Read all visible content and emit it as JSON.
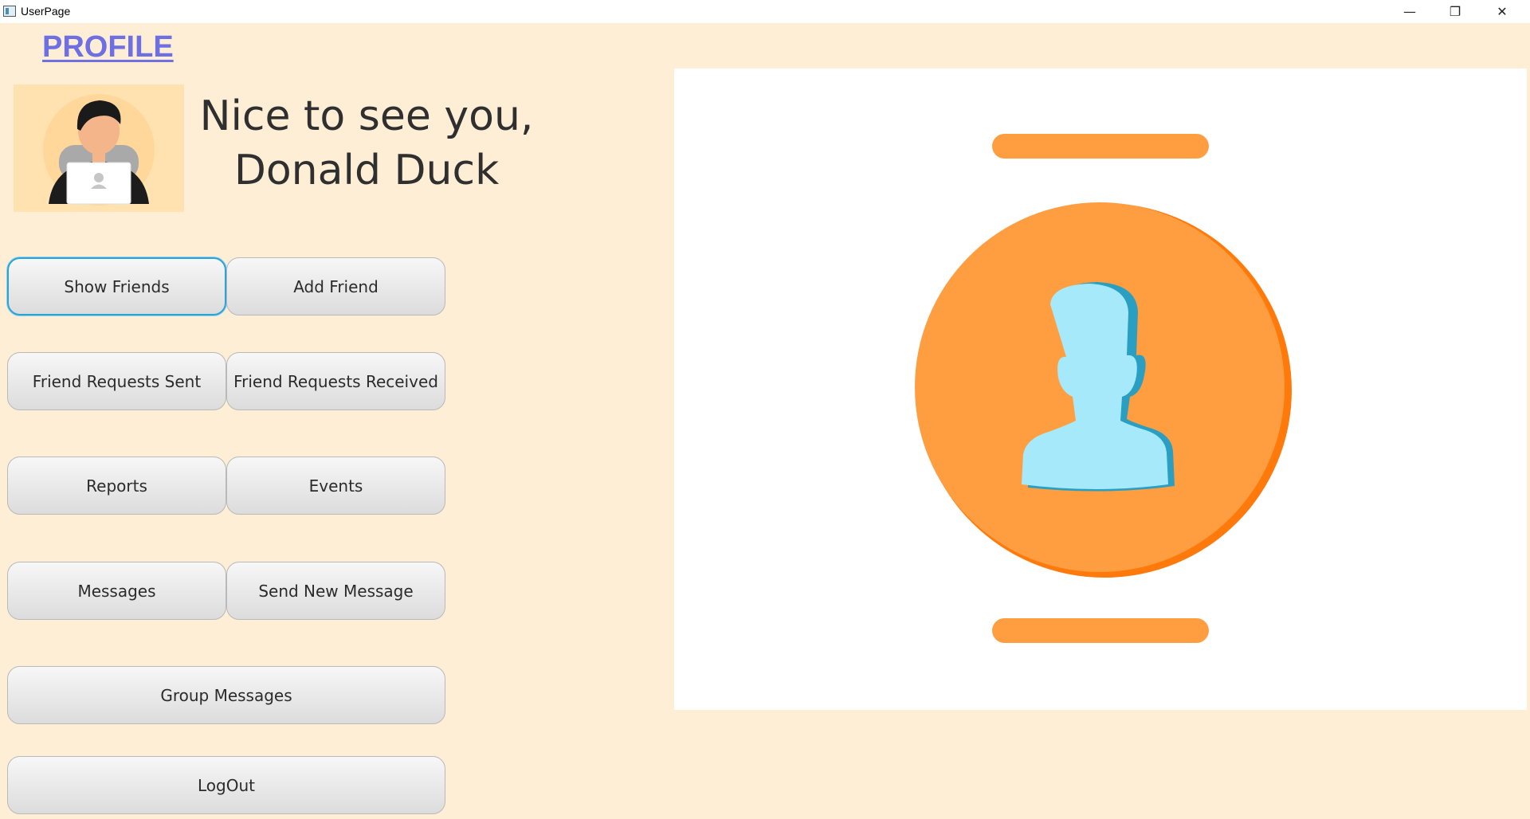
{
  "window": {
    "title": "UserPage",
    "controls": {
      "minimize": "—",
      "maximize": "❐",
      "close": "✕"
    }
  },
  "header": {
    "profile_label": "PROFILE"
  },
  "greeting": {
    "line1": "Nice to see you,",
    "line2": "Donald Duck"
  },
  "buttons": {
    "show_friends": "Show Friends",
    "add_friend": "Add Friend",
    "friend_requests_sent": "Friend Requests Sent",
    "friend_requests_received": "Friend Requests Received",
    "reports": "Reports",
    "events": "Events",
    "messages": "Messages",
    "send_new_message": "Send New Message",
    "group_messages": "Group Messages",
    "logout": "LogOut"
  },
  "colors": {
    "background": "#fdeed5",
    "accent_link": "#6f6fe4",
    "focus_ring": "#2aa3d8",
    "orange": "#ff9e40",
    "orange_dark": "#ff7a0a",
    "user_silhouette": "#a6e9fb"
  },
  "icons": {
    "avatar": "user-avatar-with-laptop",
    "profile_graphic": "user-profile-circle-icon"
  }
}
